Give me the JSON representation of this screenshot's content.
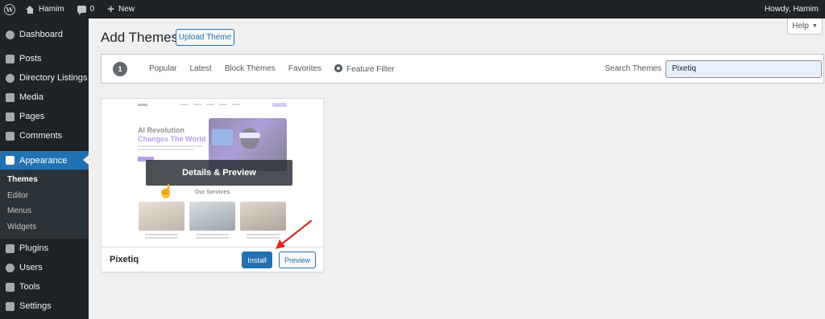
{
  "admin_bar": {
    "site_name": "Hamim",
    "comments_count": "0",
    "new_label": "New",
    "greeting": "Howdy, Hamim"
  },
  "sidebar": {
    "items": [
      {
        "label": "Dashboard",
        "icon": "dashboard-icon"
      },
      {
        "label": "Posts",
        "icon": "pin-icon"
      },
      {
        "label": "Directory Listings",
        "icon": "directory-icon"
      },
      {
        "label": "Media",
        "icon": "media-icon"
      },
      {
        "label": "Pages",
        "icon": "pages-icon"
      },
      {
        "label": "Comments",
        "icon": "comments-icon"
      },
      {
        "label": "Appearance",
        "icon": "paintbrush-icon"
      }
    ],
    "submenu": [
      {
        "label": "Themes"
      },
      {
        "label": "Editor"
      },
      {
        "label": "Menus"
      },
      {
        "label": "Widgets"
      }
    ],
    "items_after": [
      {
        "label": "Plugins",
        "icon": "plugins-icon"
      },
      {
        "label": "Users",
        "icon": "users-icon"
      },
      {
        "label": "Tools",
        "icon": "tools-icon"
      },
      {
        "label": "Settings",
        "icon": "settings-icon"
      }
    ]
  },
  "header": {
    "title": "Add Themes",
    "upload_label": "Upload Theme",
    "help_label": "Help"
  },
  "filter": {
    "count": "1",
    "tabs": [
      "Popular",
      "Latest",
      "Block Themes",
      "Favorites"
    ],
    "feature_filter": "Feature Filter",
    "search_label": "Search Themes",
    "search_value": "Pixetiq"
  },
  "theme": {
    "name": "Pixetiq",
    "overlay_label": "Details & Preview",
    "install_label": "Install",
    "preview_label": "Preview",
    "screenshot": {
      "hero_line1": "AI Revolution",
      "hero_line2": "Changes The World",
      "services_title": "Our Services"
    }
  },
  "colors": {
    "admin_bg": "#1d2327",
    "accent": "#2271b1",
    "page_bg": "#f0f0f1",
    "annotation_arrow": "#e02424"
  }
}
